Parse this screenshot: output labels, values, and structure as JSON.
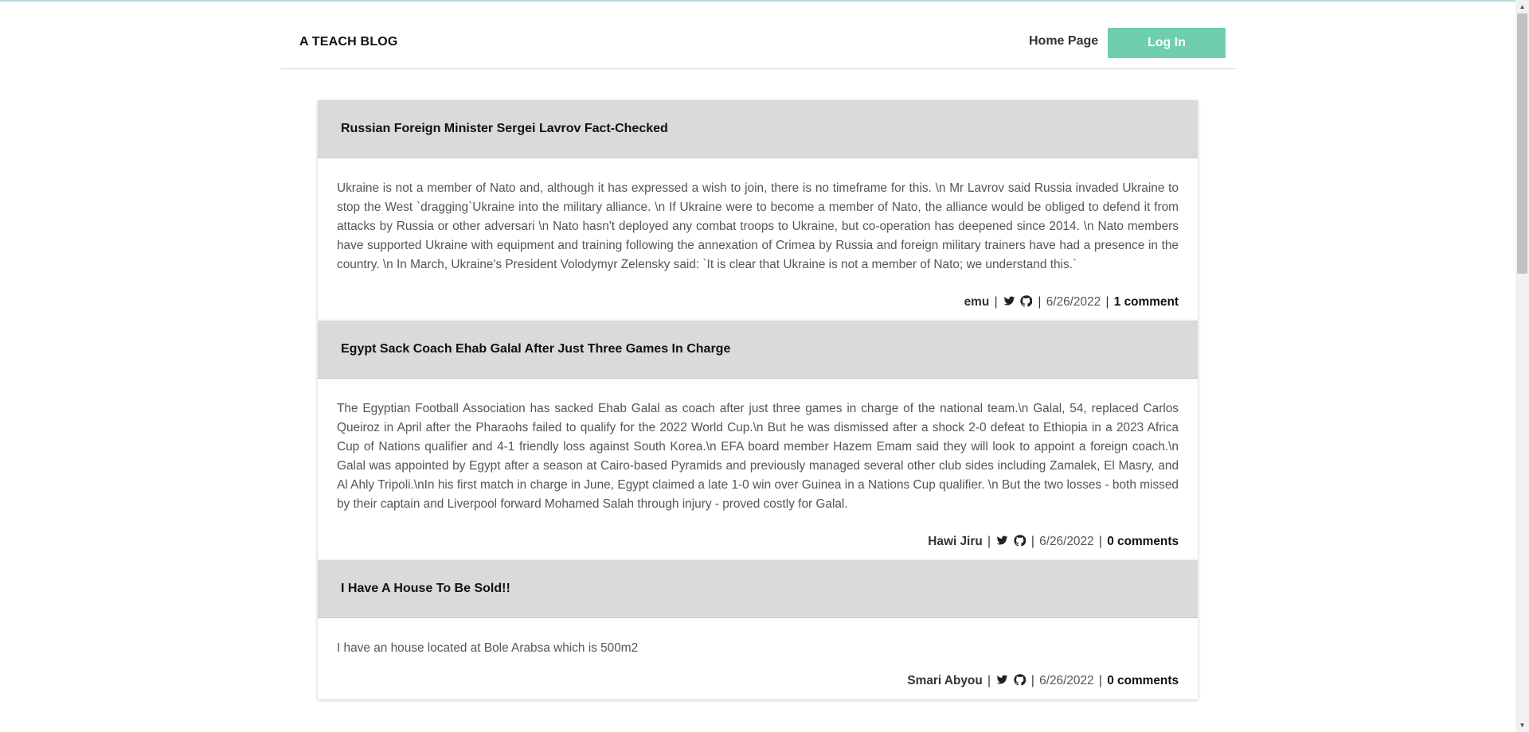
{
  "header": {
    "brand": "A TEACH BLOG",
    "nav_home": "Home Page",
    "login_label": "Log In"
  },
  "posts": [
    {
      "title": "Russian Foreign Minister Sergei Lavrov Fact-Checked",
      "body": "Ukraine is not a member of Nato and, although it has expressed a wish to join, there is no timeframe for this. \\n Mr Lavrov said Russia invaded Ukraine to stop the West `dragging`Ukraine into the military alliance. \\n If Ukraine were to become a member of Nato, the alliance would be obliged to defend it from attacks by Russia or other adversari \\n Nato hasn't deployed any combat troops to Ukraine, but co-operation has deepened since 2014. \\n Nato members have supported Ukraine with equipment and training following the annexation of Crimea by Russia and foreign military trainers have had a presence in the country. \\n In March, Ukraine's President Volodymyr Zelensky said: `It is clear that Ukraine is not a member of Nato; we understand this.`",
      "author": "emu",
      "date": "6/26/2022",
      "comments": "1 comment"
    },
    {
      "title": "Egypt Sack Coach Ehab Galal After Just Three Games In Charge",
      "body": "The Egyptian Football Association has sacked Ehab Galal as coach after just three games in charge of the national team.\\n Galal, 54, replaced Carlos Queiroz in April after the Pharaohs failed to qualify for the 2022 World Cup.\\n But he was dismissed after a shock 2-0 defeat to Ethiopia in a 2023 Africa Cup of Nations qualifier and 4-1 friendly loss against South Korea.\\n EFA board member Hazem Emam said they will look to appoint a foreign coach.\\n Galal was appointed by Egypt after a season at Cairo-based Pyramids and previously managed several other club sides including Zamalek, El Masry, and Al Ahly Tripoli.\\nIn his first match in charge in June, Egypt claimed a late 1-0 win over Guinea in a Nations Cup qualifier. \\n But the two losses - both missed by their captain and Liverpool forward Mohamed Salah through injury - proved costly for Galal.",
      "author": "Hawi Jiru",
      "date": "6/26/2022",
      "comments": "0 comments"
    },
    {
      "title": "I Have A House To Be Sold!!",
      "body": "I have an house located at Bole Arabsa which is 500m2",
      "author": "Smari Abyou",
      "date": "6/26/2022",
      "comments": "0 comments"
    }
  ],
  "icons": {
    "twitter": "twitter-icon",
    "github": "github-icon"
  },
  "colors": {
    "accent": "#6fcdb0",
    "post_header_bg": "#dadada"
  }
}
